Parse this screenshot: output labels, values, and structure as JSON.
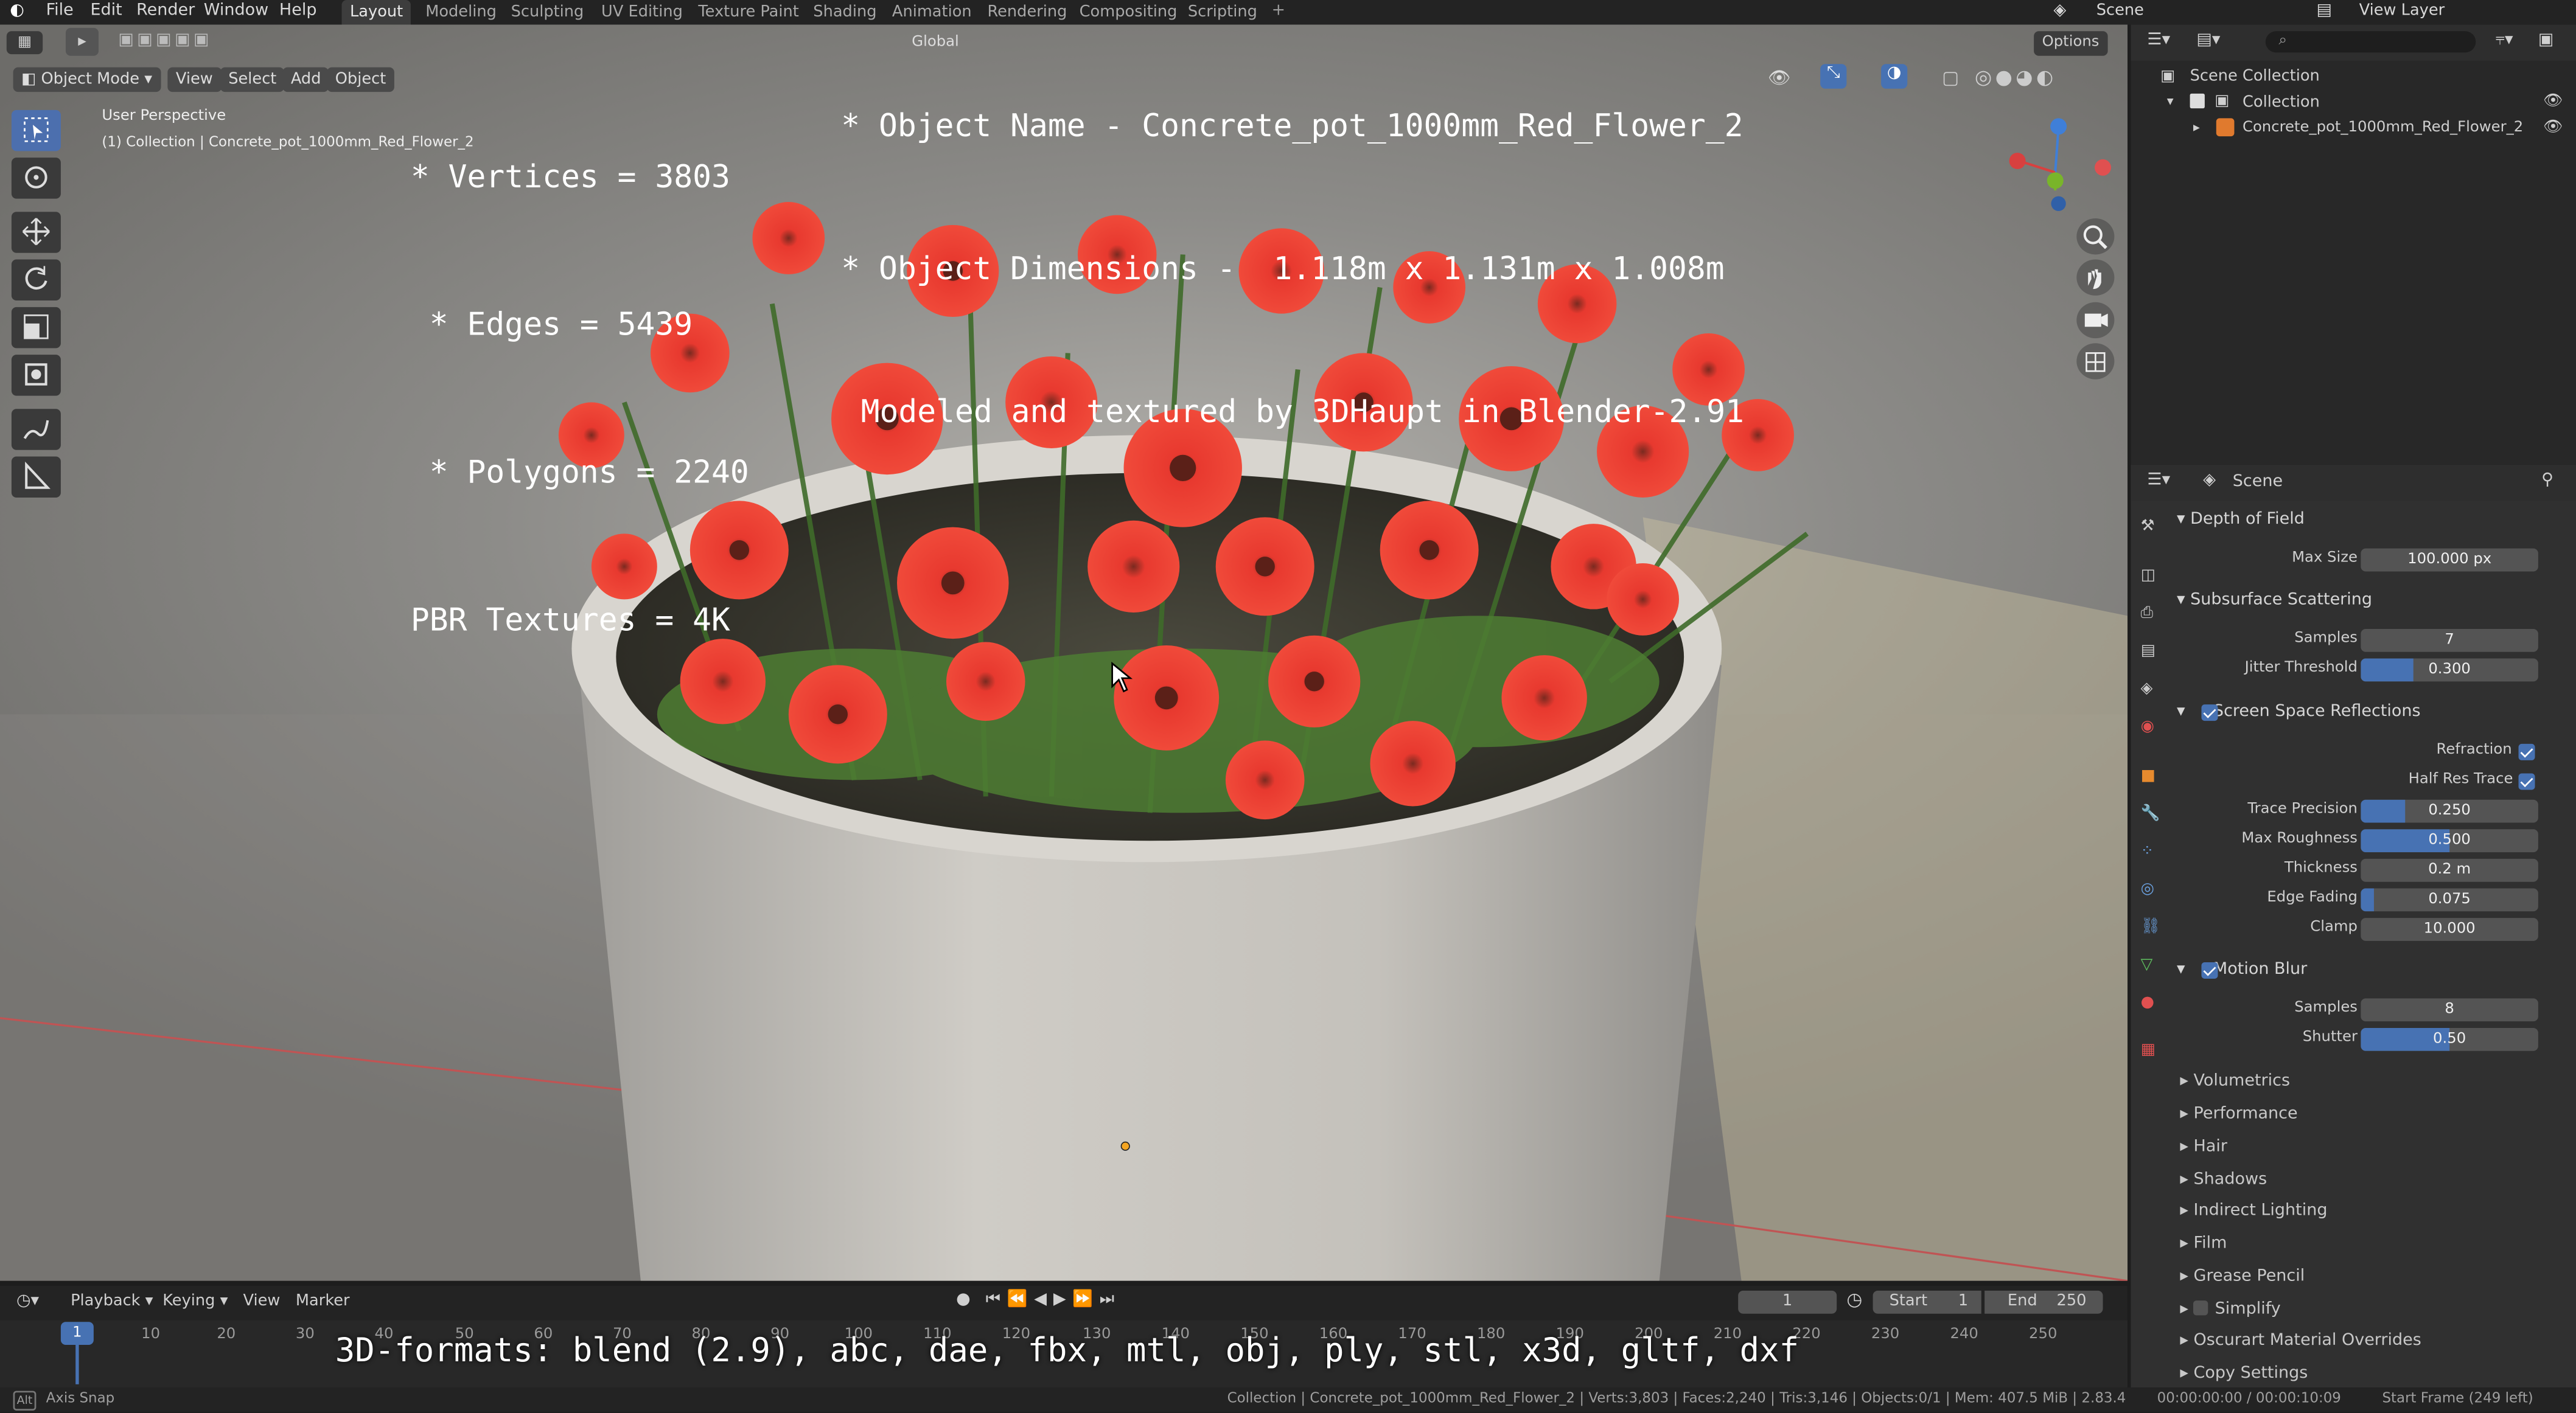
{
  "topbar": {
    "menus": [
      "File",
      "Edit",
      "Render",
      "Window",
      "Help"
    ],
    "workspaces": [
      "Layout",
      "Modeling",
      "Sculpting",
      "UV Editing",
      "Texture Paint",
      "Shading",
      "Animation",
      "Rendering",
      "Compositing",
      "Scripting"
    ],
    "active_workspace": "Layout",
    "scene": "Scene",
    "view_layer": "View Layer"
  },
  "viewport": {
    "mode": "Object Mode",
    "menus": [
      "View",
      "Select",
      "Add",
      "Object"
    ],
    "transform_orientation": "Global",
    "options_label": "Options",
    "view_name": "User Perspective",
    "collection_info": "(1) Collection | Concrete_pot_1000mm_Red_Flower_2",
    "overlay_left": [
      "* Vertices = 3803",
      " * Edges = 5439",
      " * Polygons = 2240",
      "PBR Textures = 4K"
    ],
    "overlay_right": [
      "* Object Name - Concrete_pot_1000mm_Red_Flower_2",
      "* Object Dimensions -  1.118m x 1.131m x 1.008m",
      "Modeled and textured by 3DHaupt in Blender-2.91"
    ],
    "formats_text": "3D-formats: blend (2.9), abc, dae, fbx, mtl, obj, ply, stl, x3d, gltf, dxf"
  },
  "outliner": {
    "root": "Scene Collection",
    "collection": "Collection",
    "object": "Concrete_pot_1000mm_Red_Flower_2"
  },
  "properties": {
    "context": "Scene",
    "dof": {
      "title": "Depth of Field",
      "max_size_label": "Max Size",
      "max_size": "100.000 px"
    },
    "sss": {
      "title": "Subsurface Scattering",
      "samples_label": "Samples",
      "samples": "7",
      "jitter_label": "Jitter Threshold",
      "jitter": "0.300",
      "jitter_fill": 0.3
    },
    "ssr": {
      "title": "Screen Space Reflections",
      "refraction_label": "Refraction",
      "half_res_label": "Half Res Trace",
      "rows": [
        {
          "label": "Trace Precision",
          "value": "0.250",
          "fill": 0.25
        },
        {
          "label": "Max Roughness",
          "value": "0.500",
          "fill": 0.5
        },
        {
          "label": "Thickness",
          "value": "0.2 m",
          "fill": 0
        },
        {
          "label": "Edge Fading",
          "value": "0.075",
          "fill": 0.075
        },
        {
          "label": "Clamp",
          "value": "10.000",
          "fill": 0
        }
      ]
    },
    "motion_blur": {
      "title": "Motion Blur",
      "samples_label": "Samples",
      "samples": "8",
      "shutter_label": "Shutter",
      "shutter": "0.50",
      "shutter_fill": 0.5
    },
    "collapsed": [
      "Volumetrics",
      "Performance",
      "Hair",
      "Shadows",
      "Indirect Lighting",
      "Film",
      "Grease Pencil",
      "Simplify",
      "Oscurart Material Overrides",
      "Copy Settings"
    ]
  },
  "timeline": {
    "menus": [
      "Playback",
      "Keying",
      "View",
      "Marker"
    ],
    "current_frame": "1",
    "start_label": "Start",
    "start": "1",
    "end_label": "End",
    "end": "250",
    "ticks": [
      "1",
      "10",
      "20",
      "30",
      "40",
      "50",
      "60",
      "70",
      "80",
      "90",
      "100",
      "110",
      "120",
      "130",
      "140",
      "150",
      "160",
      "170",
      "180",
      "190",
      "200",
      "210",
      "220",
      "230",
      "240",
      "250"
    ]
  },
  "statusbar": {
    "left": "Axis Snap",
    "center": "Collection | Concrete_pot_1000mm_Red_Flower_2 | Verts:3,803 | Faces:2,240 | Tris:3,146 | Objects:0/1 | Mem: 407.5 MiB | 2.83.4",
    "time": "00:00:00:00 / 00:00:10:09",
    "start_frame": "Start Frame (249 left)"
  },
  "colors": {
    "accent": "#4772b3",
    "flower": "#e8392f",
    "pot": "#c9c7c2"
  }
}
